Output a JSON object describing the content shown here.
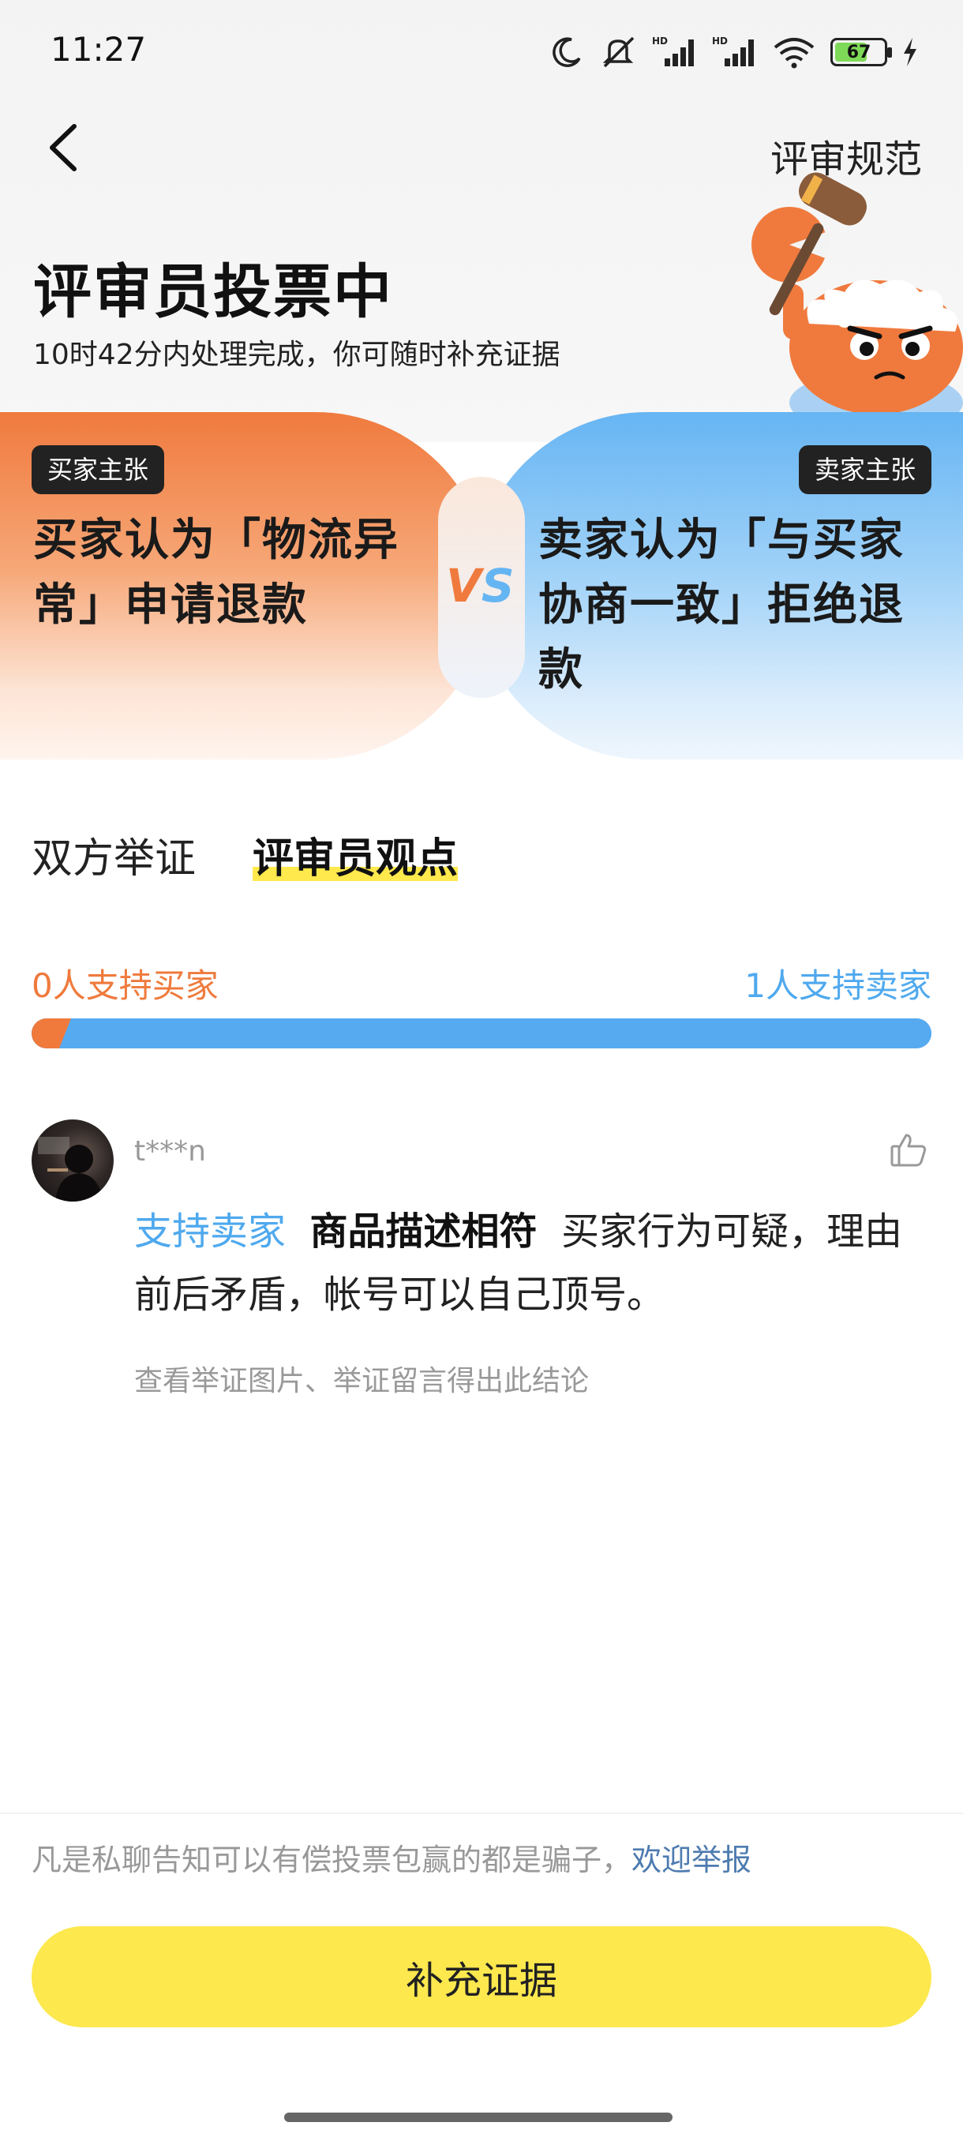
{
  "status_bar": {
    "time": "11:27",
    "battery": "67",
    "battery_level": 0.67,
    "icons": [
      "moon-icon",
      "mute-icon",
      "signal-hd-icon",
      "signal-hd-icon",
      "wifi-icon",
      "battery-icon",
      "charging-icon"
    ]
  },
  "header": {
    "back_icon": "chevron-left-icon",
    "rules_link": "评审规范",
    "title": "评审员投票中",
    "subtitle": "10时42分内处理完成，你可随时补充证据"
  },
  "claims": {
    "buyer_badge": "买家主张",
    "buyer_text": "买家认为「物流异常」申请退款",
    "seller_badge": "卖家主张",
    "seller_text": "卖家认为「与买家协商一致」拒绝退款",
    "vs_v": "V",
    "vs_s": "S"
  },
  "tabs": [
    {
      "label": "双方举证",
      "active": false
    },
    {
      "label": "评审员观点",
      "active": true
    }
  ],
  "votes": {
    "buyer_label": "0人支持买家",
    "seller_label": "1人支持卖家",
    "buyer_count": 0,
    "seller_count": 1
  },
  "opinion": {
    "username": "t***n",
    "stance": "支持卖家",
    "reason": "商品描述相符",
    "text": "买家行为可疑，理由前后矛盾，帐号可以自己顶号。",
    "note": "查看举证图片、举证留言得出此结论"
  },
  "footer": {
    "warning": "凡是私聊告知可以有偿投票包赢的都是骗子，",
    "report_link": "欢迎举报",
    "submit_label": "补充证据"
  },
  "colors": {
    "buyer": "#ef7a3c",
    "seller": "#4fa9ee",
    "button": "#fde84e",
    "tab_highlight": "#ffe94d"
  }
}
